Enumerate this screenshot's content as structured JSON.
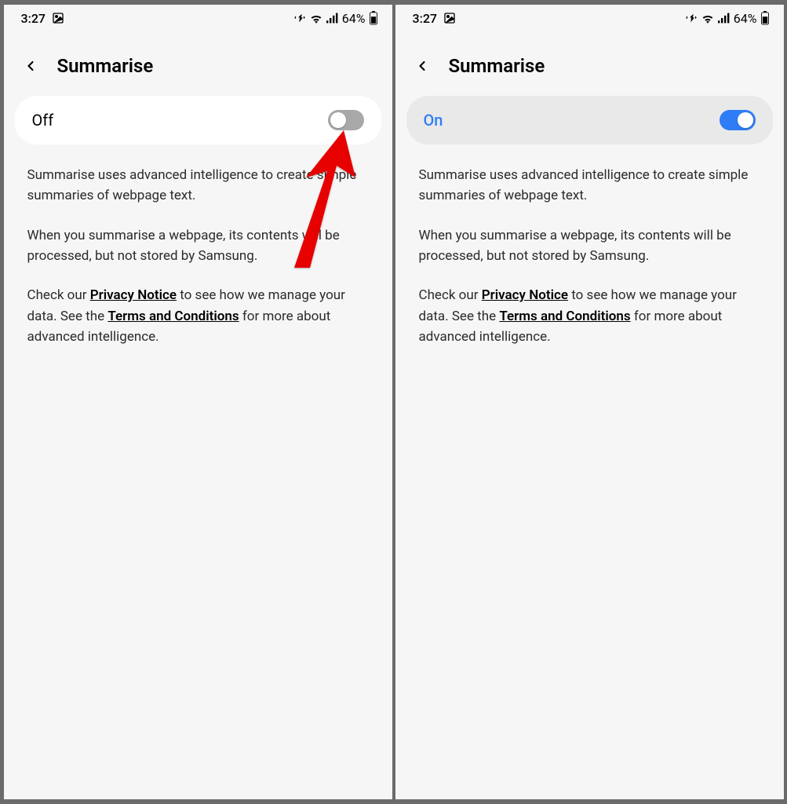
{
  "status": {
    "time": "3:27",
    "battery": "64%"
  },
  "header": {
    "title": "Summarise"
  },
  "panels": {
    "left": {
      "toggle_label": "Off",
      "toggle_state": "off"
    },
    "right": {
      "toggle_label": "On",
      "toggle_state": "on"
    }
  },
  "description": {
    "p1": "Summarise uses advanced intelligence to create simple summaries of webpage text.",
    "p2": "When you summarise a webpage, its contents will be processed, but not stored by Samsung.",
    "p3_a": "Check our ",
    "p3_link1": "Privacy Notice",
    "p3_b": " to see how we manage your data. See the ",
    "p3_link2": "Terms and Conditions",
    "p3_c": " for more about advanced intelligence."
  },
  "colors": {
    "accent": "#2f7df6",
    "switch_off": "#a8a8a8",
    "card_on": "#e9e9e9",
    "card_off": "#ffffff",
    "arrow": "#e60000"
  }
}
